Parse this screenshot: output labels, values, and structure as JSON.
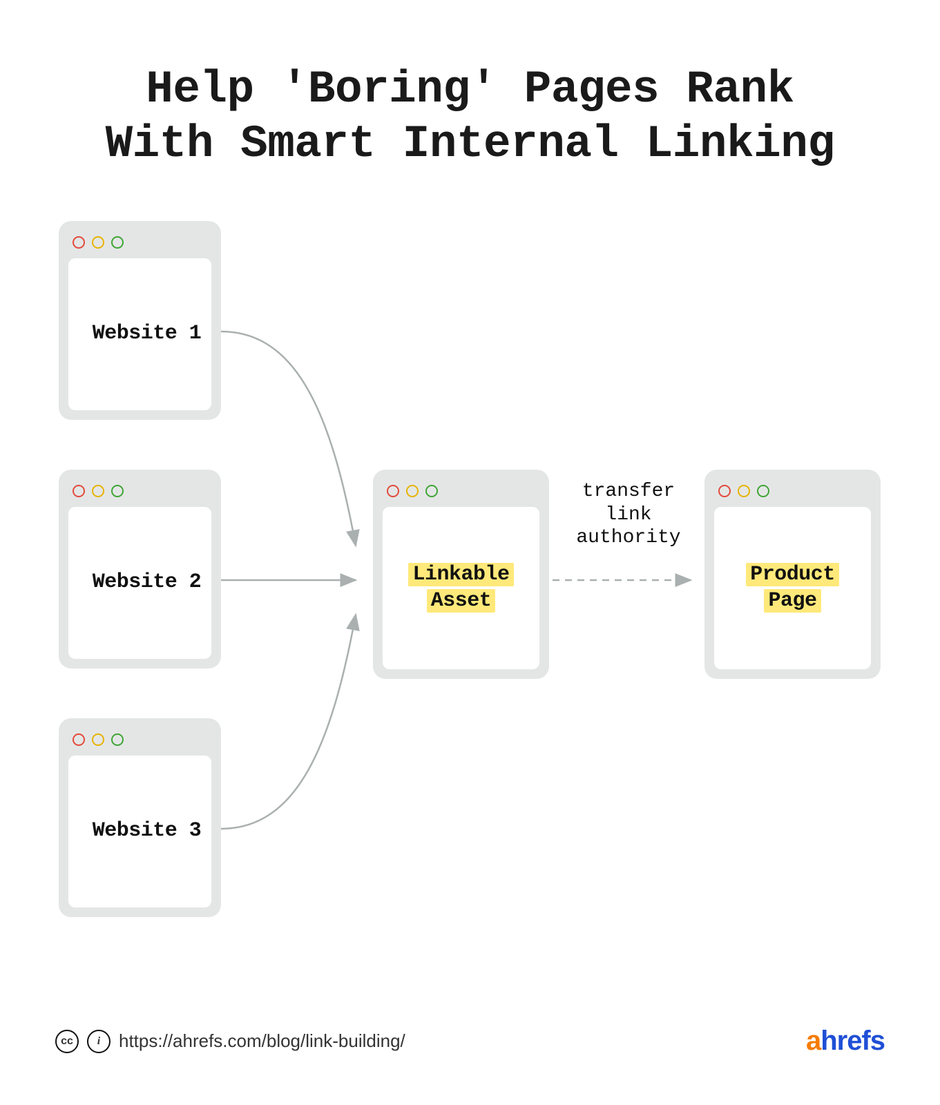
{
  "title_line1": "Help 'Boring' Pages Rank",
  "title_line2": "With Smart Internal Linking",
  "websites": [
    {
      "label": "Website 1"
    },
    {
      "label": "Website 2"
    },
    {
      "label": "Website 3"
    }
  ],
  "linkable_asset": {
    "label_line1": "Linkable",
    "label_line2": "Asset"
  },
  "product_page": {
    "label_line1": "Product",
    "label_line2": "Page"
  },
  "annotation": {
    "line1": "transfer",
    "line2": "link",
    "line3": "authority"
  },
  "footer": {
    "url": "https://ahrefs.com/blog/link-building/",
    "cc_label": "cc",
    "by_label": "i",
    "brand_a": "a",
    "brand_rest": "hrefs"
  },
  "colors": {
    "window_bg": "#e4e6e6",
    "highlight": "#ffe97a",
    "red": "#e24a3b",
    "yellow": "#e6b400",
    "green": "#3fa535",
    "arrow": "#aab0b0",
    "brand_orange": "#f57c00",
    "brand_blue": "#1f4fd6"
  }
}
